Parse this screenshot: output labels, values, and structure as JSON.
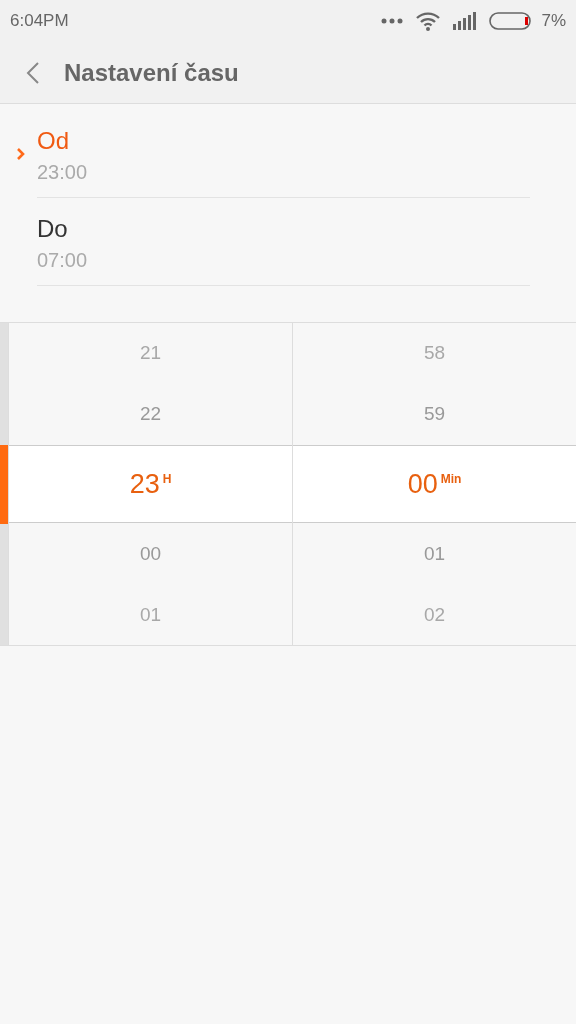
{
  "status_bar": {
    "time": "6:04PM",
    "battery": "7%"
  },
  "header": {
    "title": "Nastavení času"
  },
  "ranges": [
    {
      "label": "Od",
      "value": "23:00",
      "selected": true
    },
    {
      "label": "Do",
      "value": "07:00",
      "selected": false
    }
  ],
  "picker": {
    "columns": [
      {
        "unit": "H",
        "items": [
          {
            "value": "21",
            "selected": false
          },
          {
            "value": "22",
            "selected": false
          },
          {
            "value": "23",
            "selected": true
          },
          {
            "value": "00",
            "selected": false
          },
          {
            "value": "01",
            "selected": false
          }
        ]
      },
      {
        "unit": "Min",
        "items": [
          {
            "value": "58",
            "selected": false
          },
          {
            "value": "59",
            "selected": false
          },
          {
            "value": "00",
            "selected": true
          },
          {
            "value": "01",
            "selected": false
          },
          {
            "value": "02",
            "selected": false
          }
        ]
      }
    ]
  }
}
